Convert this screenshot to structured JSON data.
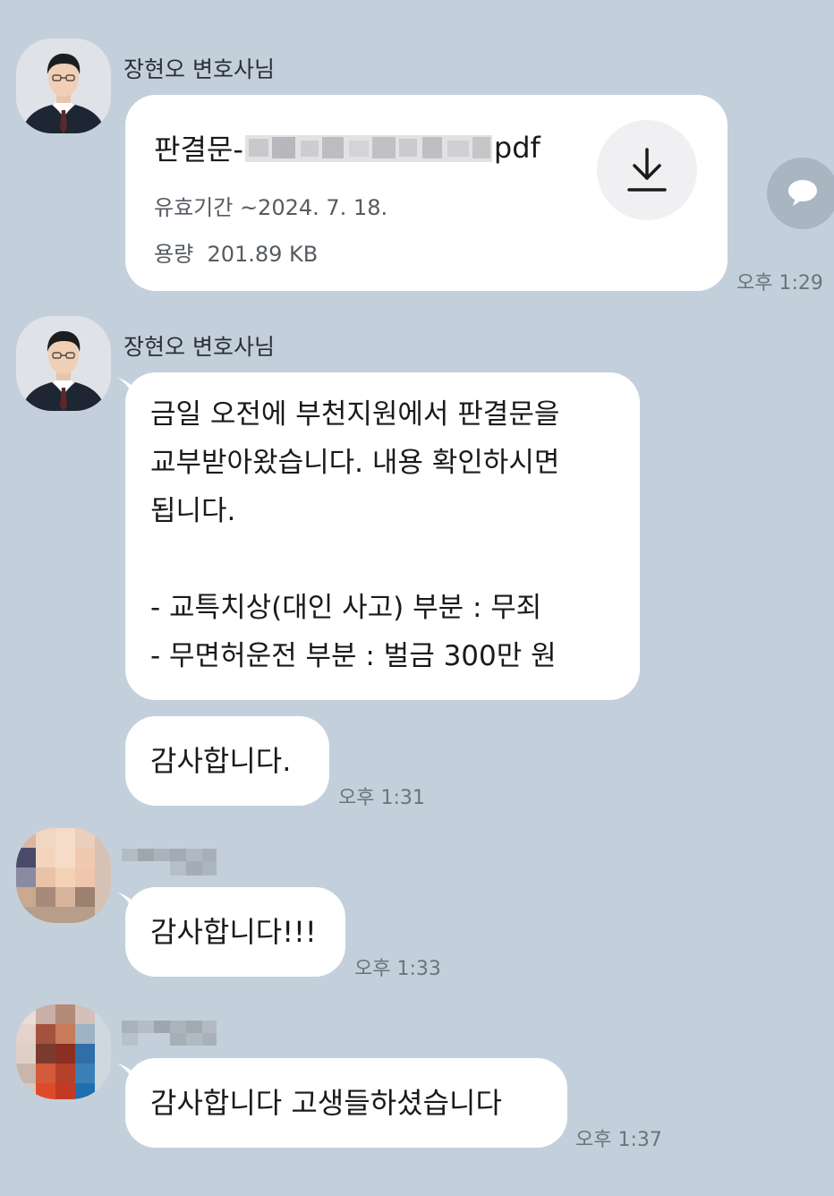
{
  "chat": {
    "lawyer_name": "장현오 변호사님",
    "file": {
      "name_prefix": "판결문-",
      "name_suffix": "pdf",
      "expiry": "유효기간 ~2024. 7. 18.",
      "size_label": "용량",
      "size_value": "201.89 KB",
      "time": "오후 1:29",
      "download_icon": "download-icon"
    },
    "message": {
      "text": "금일 오전에 부천지원에서 판결문을\n교부받아왔습니다. 내용 확인하시면\n됩니다.\n\n- 교특치상(대인 사고) 부분 : 무죄\n- 무면허운전 부분 : 벌금 300만 원"
    },
    "thanks_lawyer": {
      "text": "감사합니다.",
      "time": "오후 1:31"
    },
    "thanks_user2": {
      "text": "감사합니다!!!",
      "time": "오후 1:33"
    },
    "thanks_user3": {
      "text": "감사합니다 고생들하셨습니다",
      "time": "오후 1:37"
    },
    "colors": {
      "background": "#c3d0dc",
      "bubble": "#ffffff",
      "time_text": "#6c737b"
    }
  }
}
